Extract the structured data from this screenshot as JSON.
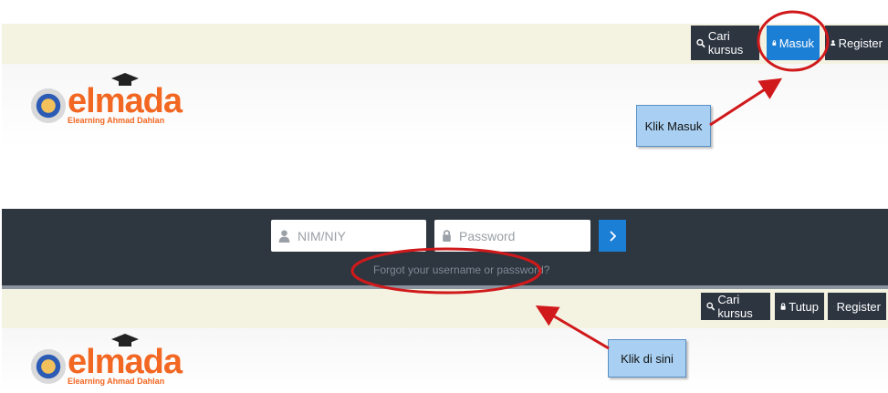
{
  "top_panel": {
    "nav": {
      "search_label": "Cari kursus",
      "login_label": "Masuk",
      "register_label": "Register"
    },
    "logo": {
      "name": "elmada",
      "tagline": "Elearning Ahmad Dahlan"
    },
    "callout": "Klik Masuk"
  },
  "login_bar": {
    "username_placeholder": "NIM/NIY",
    "password_placeholder": "Password",
    "submit_icon": "chevron-right-icon",
    "forgot_link": "Forgot your username or password?"
  },
  "bottom_panel": {
    "nav": {
      "search_label": "Cari kursus",
      "close_label": "Tutup",
      "register_label": "Register"
    },
    "logo": {
      "name": "elmada",
      "tagline": "Elearning Ahmad Dahlan"
    },
    "callout": "Klik di sini"
  },
  "colors": {
    "nav_dark": "#2d3541",
    "accent_blue": "#1c7fd6",
    "logo_orange": "#f26722",
    "annotation_red": "#d0191b",
    "callout_blue": "#a9d0f2"
  }
}
